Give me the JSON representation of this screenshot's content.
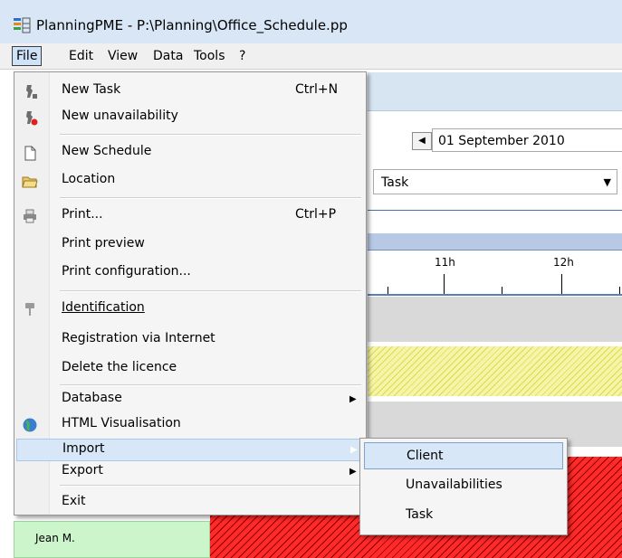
{
  "window": {
    "title": "PlanningPME - P:\\Planning\\Office_Schedule.pp"
  },
  "menubar": {
    "items": [
      "File",
      "Edit",
      "View",
      "Data",
      "Tools",
      "?"
    ]
  },
  "toolbar": {
    "date": "01 September 2010",
    "view_select": "Task"
  },
  "timeline": {
    "hours": [
      "11h",
      "12h"
    ]
  },
  "resource": {
    "name": "Jean M."
  },
  "file_menu": {
    "items": [
      {
        "label": "New Task",
        "shortcut": "Ctrl+N",
        "icon": "new-task-icon"
      },
      {
        "label": "New unavailability",
        "shortcut": "",
        "icon": "new-unavailability-icon"
      },
      {
        "label": "New Schedule",
        "shortcut": "",
        "icon": "new-document-icon"
      },
      {
        "label": "Location",
        "shortcut": "",
        "icon": "open-folder-icon"
      },
      {
        "label": "Print...",
        "shortcut": "Ctrl+P",
        "icon": "printer-icon"
      },
      {
        "label": "Print preview",
        "shortcut": "",
        "icon": ""
      },
      {
        "label": "Print configuration...",
        "shortcut": "",
        "icon": ""
      },
      {
        "label": "Identification",
        "shortcut": "",
        "icon": "key-icon"
      },
      {
        "label": "Registration via Internet",
        "shortcut": "",
        "icon": ""
      },
      {
        "label": "Delete the licence",
        "shortcut": "",
        "icon": ""
      },
      {
        "label": "Database",
        "shortcut": "",
        "icon": "",
        "submenu": true
      },
      {
        "label": "HTML Visualisation",
        "shortcut": "",
        "icon": "globe-icon"
      },
      {
        "label": "Import",
        "shortcut": "",
        "icon": "",
        "submenu": true,
        "highlighted": true
      },
      {
        "label": "Export",
        "shortcut": "",
        "icon": "",
        "submenu": true
      },
      {
        "label": "Exit",
        "shortcut": "",
        "icon": ""
      }
    ]
  },
  "import_submenu": {
    "items": [
      "Client",
      "Unavailabilities",
      "Task"
    ],
    "highlighted": "Client"
  },
  "colors": {
    "menu_highlight": "#d8e7f7",
    "row_red": "#ff2a2a",
    "row_yellow": "#f5f5a8",
    "resource_green": "#ccf5cc"
  }
}
